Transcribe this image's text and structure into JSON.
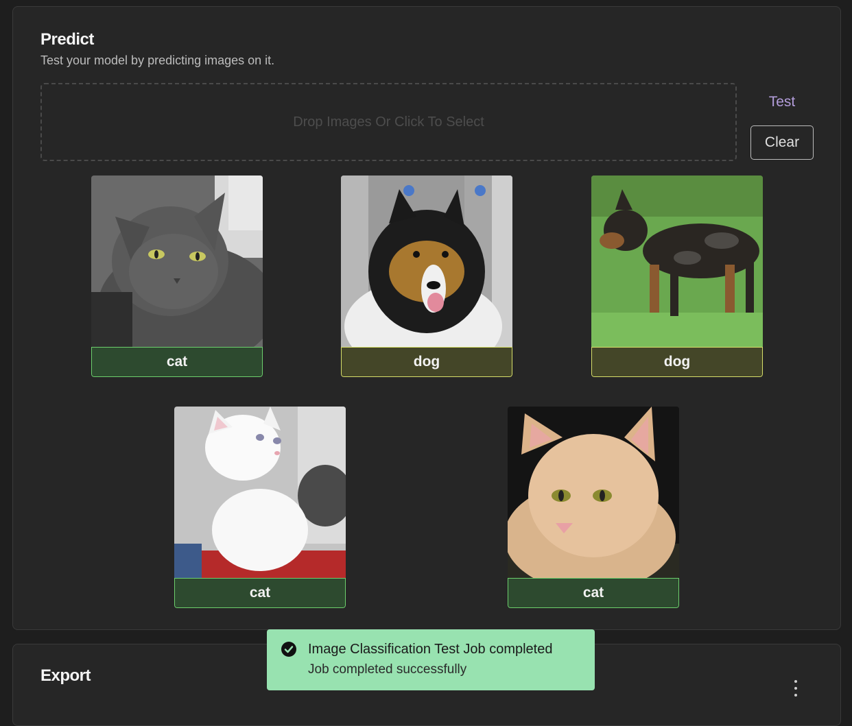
{
  "predict": {
    "title": "Predict",
    "subtitle": "Test your model by predicting images on it.",
    "dropzone_text": "Drop Images Or Click To Select",
    "test_label": "Test",
    "clear_label": "Clear",
    "results": [
      {
        "label": "cat",
        "kind": "cat",
        "image": "gray-cat-photo"
      },
      {
        "label": "dog",
        "kind": "dog",
        "image": "collie-dog-photo"
      },
      {
        "label": "dog",
        "kind": "dog",
        "image": "black-tan-dog-photo"
      },
      {
        "label": "cat",
        "kind": "cat",
        "image": "white-kitten-photo"
      },
      {
        "label": "cat",
        "kind": "cat",
        "image": "orange-cat-photo"
      }
    ]
  },
  "export": {
    "title": "Export"
  },
  "toast": {
    "title": "Image Classification Test Job completed",
    "message": "Job completed successfully",
    "icon": "check-circle-icon"
  },
  "colors": {
    "cat_label_bg": "#2d4a2f",
    "cat_label_border": "#6dd06d",
    "dog_label_bg": "#444628",
    "dog_label_border": "#d8e06a",
    "accent": "#b39ddb",
    "toast_bg": "#98e2b0"
  }
}
